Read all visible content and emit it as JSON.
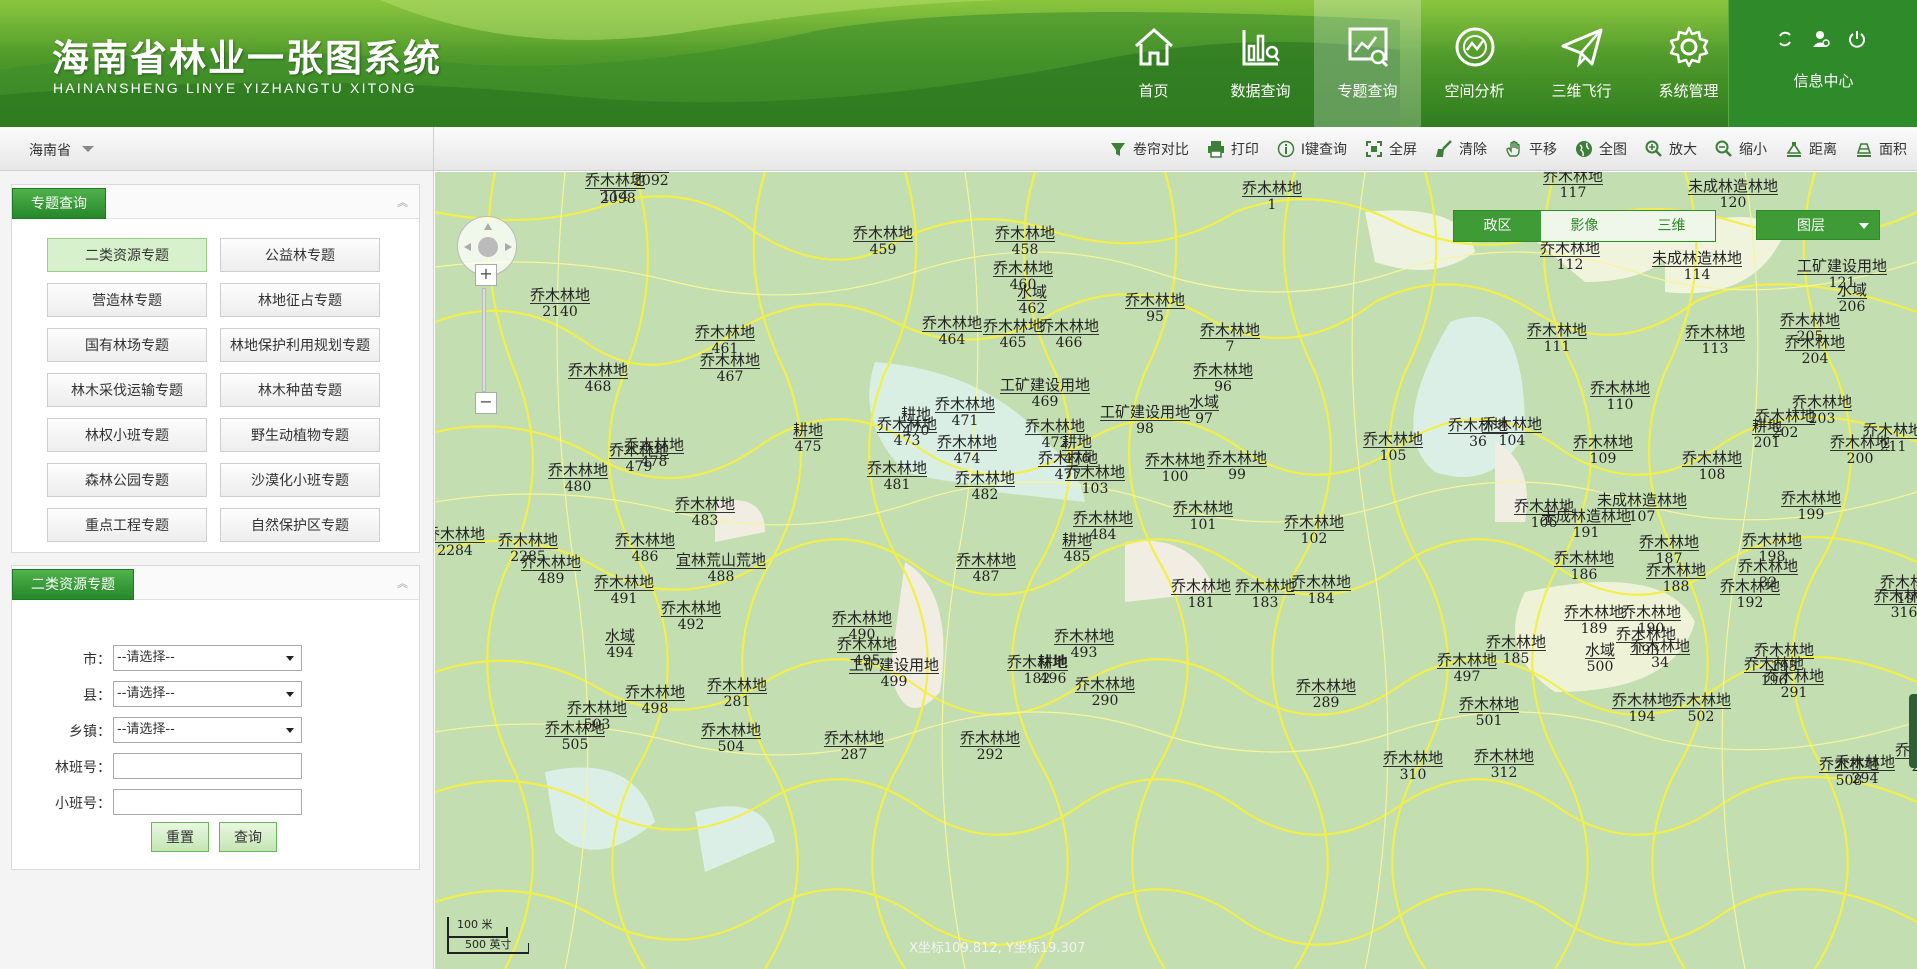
{
  "header": {
    "title_cn": "海南省林业一张图系统",
    "title_en": "HAINANSHENG LINYE YIZHANGTU XITONG",
    "nav": [
      {
        "label": "首页",
        "icon": "home-icon"
      },
      {
        "label": "数据查询",
        "icon": "data-query-icon"
      },
      {
        "label": "专题查询",
        "icon": "topic-query-icon",
        "active": true
      },
      {
        "label": "空间分析",
        "icon": "spatial-analysis-icon"
      },
      {
        "label": "三维飞行",
        "icon": "paper-plane-icon"
      },
      {
        "label": "系统管理",
        "icon": "gear-icon"
      }
    ],
    "info_center": "信息中心"
  },
  "toolbar": {
    "province": "海南省",
    "tools": [
      {
        "label": "卷帘对比",
        "icon": "swipe-compare-icon"
      },
      {
        "label": "打印",
        "icon": "printer-icon"
      },
      {
        "label": "I键查询",
        "icon": "info-icon"
      },
      {
        "label": "全屏",
        "icon": "fullscreen-icon"
      },
      {
        "label": "清除",
        "icon": "clear-icon"
      },
      {
        "label": "平移",
        "icon": "hand-icon"
      },
      {
        "label": "全图",
        "icon": "globe-icon"
      },
      {
        "label": "放大",
        "icon": "zoom-in-icon"
      },
      {
        "label": "缩小",
        "icon": "zoom-out-icon"
      },
      {
        "label": "距离",
        "icon": "ruler-icon"
      },
      {
        "label": "面积",
        "icon": "area-icon"
      }
    ]
  },
  "sidebar": {
    "topic_panel_title": "专题查询",
    "topics": [
      "二类资源专题",
      "公益林专题",
      "营造林专题",
      "林地征占专题",
      "国有林场专题",
      "林地保护利用规划专题",
      "林木采伐运输专题",
      "林木种苗专题",
      "林权小班专题",
      "野生动植物专题",
      "森林公园专题",
      "沙漠化小班专题",
      "重点工程专题",
      "自然保护区专题"
    ],
    "active_topic": "二类资源专题",
    "form_panel_title": "二类资源专题",
    "form": {
      "city_label": "市：",
      "city_value": "--请选择--",
      "county_label": "县：",
      "county_value": "--请选择--",
      "town_label": "乡镇：",
      "town_value": "--请选择--",
      "forest_class_label": "林班号：",
      "sub_class_label": "小班号：",
      "reset": "重置",
      "query": "查询"
    }
  },
  "map": {
    "layer_tabs": [
      "政区",
      "影像",
      "三维"
    ],
    "active_layer": "政区",
    "layers_button": "图层",
    "coords": "X坐标109.812, Y坐标19.307",
    "scale_m": "100 米",
    "scale_ft": "500 英寸",
    "labels": [
      {
        "t": "乔木林地",
        "n": "114"
      },
      {
        "t": "",
        "n": "2098"
      },
      {
        "t": "",
        "n": "2092"
      },
      {
        "t": "乔木林地",
        "n": "1"
      },
      {
        "t": "乔木林地",
        "n": "117"
      },
      {
        "t": "未成林造林地",
        "n": "120"
      },
      {
        "t": "乔木林地",
        "n": "459"
      },
      {
        "t": "乔木林地",
        "n": "458"
      },
      {
        "t": "乔木林地",
        "n": "460"
      },
      {
        "t": "乔木林地",
        "n": "2140"
      },
      {
        "t": "乔木林地",
        "n": "461"
      },
      {
        "t": "水域",
        "n": "462"
      },
      {
        "t": "乔木林地",
        "n": "95"
      },
      {
        "t": "乔木林地",
        "n": "112"
      },
      {
        "t": "未成林造林地",
        "n": "114"
      },
      {
        "t": "工矿建设用地",
        "n": "121"
      },
      {
        "t": "水域",
        "n": "206"
      },
      {
        "t": "乔木林地",
        "n": "464"
      },
      {
        "t": "乔木林地",
        "n": "465"
      },
      {
        "t": "乔木林地",
        "n": "466"
      },
      {
        "t": "乔木林地",
        "n": "7"
      },
      {
        "t": "乔木林地",
        "n": "111"
      },
      {
        "t": "乔木林地",
        "n": "113"
      },
      {
        "t": "乔木林地",
        "n": "205"
      },
      {
        "t": "乔木林地",
        "n": "204"
      },
      {
        "t": "乔木林地",
        "n": "468"
      },
      {
        "t": "乔木林地",
        "n": "467"
      },
      {
        "t": "乔木林地",
        "n": "96"
      },
      {
        "t": "工矿建设用地",
        "n": "469"
      },
      {
        "t": "乔木林地",
        "n": "110"
      },
      {
        "t": "乔木林地",
        "n": "203"
      },
      {
        "t": "乔木林地",
        "n": "471"
      },
      {
        "t": "耕地",
        "n": "470"
      },
      {
        "t": "水域",
        "n": "97"
      },
      {
        "t": "工矿建设用地",
        "n": "98"
      },
      {
        "t": "乔木林地",
        "n": "104"
      },
      {
        "t": "乔木林地",
        "n": "202"
      },
      {
        "t": "乔木林地",
        "n": "473"
      },
      {
        "t": "乔木林地",
        "n": "472"
      },
      {
        "t": "乔木林地",
        "n": "36"
      },
      {
        "t": "耕地",
        "n": "201"
      },
      {
        "t": "乔木林地",
        "n": "211"
      },
      {
        "t": "耕地",
        "n": "475"
      },
      {
        "t": "乔木林地",
        "n": "474"
      },
      {
        "t": "耕地",
        "n": "476"
      },
      {
        "t": "乔木林地",
        "n": "105"
      },
      {
        "t": "乔木林地",
        "n": "109"
      },
      {
        "t": "乔木林地",
        "n": "200"
      },
      {
        "t": "乔木林地",
        "n": "478"
      },
      {
        "t": "乔木林地",
        "n": "479"
      },
      {
        "t": "乔木林地",
        "n": "477"
      },
      {
        "t": "乔木林地",
        "n": "100"
      },
      {
        "t": "乔木林地",
        "n": "99"
      },
      {
        "t": "乔木林地",
        "n": "108"
      },
      {
        "t": "乔木林地",
        "n": "480"
      },
      {
        "t": "乔木林地",
        "n": "481"
      },
      {
        "t": "乔木林地",
        "n": "482"
      },
      {
        "t": "乔木林地",
        "n": "103"
      },
      {
        "t": "未成林造林地",
        "n": "107"
      },
      {
        "t": "乔木林地",
        "n": "199"
      },
      {
        "t": "乔木林地",
        "n": "101"
      },
      {
        "t": "乔木林地",
        "n": "106"
      },
      {
        "t": "乔木林地",
        "n": "483"
      },
      {
        "t": "乔木林地",
        "n": "484"
      },
      {
        "t": "乔木林地",
        "n": "102"
      },
      {
        "t": "未成林造林地",
        "n": "191"
      },
      {
        "t": "乔木林地",
        "n": "2284"
      },
      {
        "t": "乔木林地",
        "n": "2285"
      },
      {
        "t": "乔木林地",
        "n": "486"
      },
      {
        "t": "耕地",
        "n": "485"
      },
      {
        "t": "乔木林地",
        "n": "187"
      },
      {
        "t": "乔木林地",
        "n": "198"
      },
      {
        "t": "乔木林地",
        "n": "489"
      },
      {
        "t": "乔木林地",
        "n": "487"
      },
      {
        "t": "宜林荒山荒地",
        "n": "488"
      },
      {
        "t": "乔木林地",
        "n": "186"
      },
      {
        "t": "乔木林地",
        "n": "32"
      },
      {
        "t": "乔木林地",
        "n": "188"
      },
      {
        "t": "乔木林地",
        "n": "491"
      },
      {
        "t": "乔木林地",
        "n": "184"
      },
      {
        "t": "乔木林地",
        "n": "197"
      },
      {
        "t": "乔木林地",
        "n": "181"
      },
      {
        "t": "乔木林地",
        "n": "183"
      },
      {
        "t": "乔木林地",
        "n": "192"
      },
      {
        "t": "乔木林地",
        "n": "316"
      },
      {
        "t": "乔木林地",
        "n": "490"
      },
      {
        "t": "乔木林地",
        "n": "492"
      },
      {
        "t": "乔木林地",
        "n": "189"
      },
      {
        "t": "乔木林地",
        "n": "190"
      },
      {
        "t": "水域",
        "n": "494"
      },
      {
        "t": "乔木林地",
        "n": "493"
      },
      {
        "t": "乔木林地",
        "n": "193"
      },
      {
        "t": "乔木林地",
        "n": "495"
      },
      {
        "t": "乔木林地",
        "n": "185"
      },
      {
        "t": "乔木林地",
        "n": "34"
      },
      {
        "t": "耕地",
        "n": "496"
      },
      {
        "t": "乔木林地",
        "n": "195"
      },
      {
        "t": "乔木林地",
        "n": "497"
      },
      {
        "t": "乔木林地",
        "n": "182"
      },
      {
        "t": "乔木林地",
        "n": "196"
      },
      {
        "t": "工矿建设用地",
        "n": "499"
      },
      {
        "t": "水域",
        "n": "500"
      },
      {
        "t": "乔木林地",
        "n": "291"
      },
      {
        "t": "乔木林地",
        "n": "498"
      },
      {
        "t": "乔木林地",
        "n": "281"
      },
      {
        "t": "乔木林地",
        "n": "289"
      },
      {
        "t": "乔木林地",
        "n": "290"
      },
      {
        "t": "乔木林地",
        "n": "194"
      },
      {
        "t": "乔木林地",
        "n": "501"
      },
      {
        "t": "乔木林地",
        "n": "502"
      },
      {
        "t": "乔木林地",
        "n": "503"
      },
      {
        "t": "乔木林地",
        "n": "504"
      },
      {
        "t": "乔木林地",
        "n": "505"
      },
      {
        "t": "乔木林地",
        "n": "287"
      },
      {
        "t": "乔木林地",
        "n": "292"
      },
      {
        "t": "乔木林地",
        "n": "310"
      },
      {
        "t": "乔木林地",
        "n": "312"
      },
      {
        "t": "乔木林地",
        "n": "508"
      },
      {
        "t": "乔木林地",
        "n": "294"
      },
      {
        "t": "乔木林地",
        "n": "293"
      }
    ]
  }
}
